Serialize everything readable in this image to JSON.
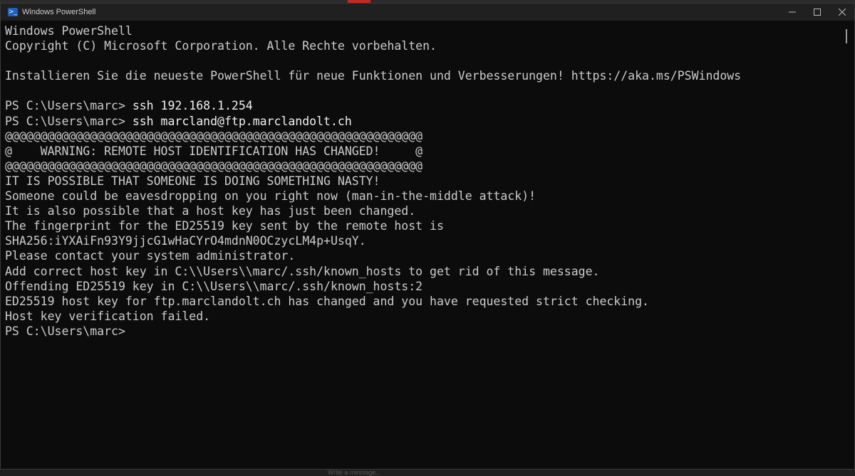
{
  "window": {
    "title": "Windows PowerShell"
  },
  "terminal": {
    "lines": [
      {
        "text": "Windows PowerShell"
      },
      {
        "text": "Copyright (C) Microsoft Corporation. Alle Rechte vorbehalten."
      },
      {
        "text": ""
      },
      {
        "text": "Installieren Sie die neueste PowerShell für neue Funktionen und Verbesserungen! https://aka.ms/PSWindows"
      },
      {
        "text": ""
      },
      {
        "prompt": "PS C:\\Users\\marc> ",
        "command": "ssh 192.168.1.254"
      },
      {
        "prompt": "PS C:\\Users\\marc> ",
        "command": "ssh marcland@ftp.marclandolt.ch"
      },
      {
        "text": "@@@@@@@@@@@@@@@@@@@@@@@@@@@@@@@@@@@@@@@@@@@@@@@@@@@@@@@@@@@"
      },
      {
        "text": "@    WARNING: REMOTE HOST IDENTIFICATION HAS CHANGED!     @"
      },
      {
        "text": "@@@@@@@@@@@@@@@@@@@@@@@@@@@@@@@@@@@@@@@@@@@@@@@@@@@@@@@@@@@"
      },
      {
        "text": "IT IS POSSIBLE THAT SOMEONE IS DOING SOMETHING NASTY!"
      },
      {
        "text": "Someone could be eavesdropping on you right now (man-in-the-middle attack)!"
      },
      {
        "text": "It is also possible that a host key has just been changed."
      },
      {
        "text": "The fingerprint for the ED25519 key sent by the remote host is"
      },
      {
        "text": "SHA256:iYXAiFn93Y9jjcG1wHaCYrO4mdnN0OCzycLM4p+UsqY."
      },
      {
        "text": "Please contact your system administrator."
      },
      {
        "text": "Add correct host key in C:\\\\Users\\\\marc/.ssh/known_hosts to get rid of this message."
      },
      {
        "text": "Offending ED25519 key in C:\\\\Users\\\\marc/.ssh/known_hosts:2"
      },
      {
        "text": "ED25519 host key for ftp.marclandolt.ch has changed and you have requested strict checking."
      },
      {
        "text": "Host key verification failed."
      },
      {
        "prompt": "PS C:\\Users\\marc> ",
        "command": ""
      }
    ]
  },
  "background": {
    "message_hint": "Write a message..."
  },
  "colors": {
    "terminal_bg": "#0c0c0c",
    "terminal_fg": "#cccccc",
    "titlebar_bg": "#202020",
    "ps_icon": "#1f5fbf"
  },
  "icons": {
    "app": "powershell-icon",
    "minimize": "minimize-icon",
    "maximize": "maximize-icon",
    "close": "close-icon"
  }
}
